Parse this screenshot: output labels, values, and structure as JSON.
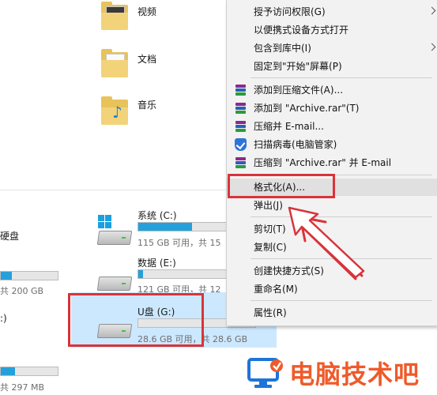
{
  "folders": [
    {
      "label": "视频",
      "icon": "video-folder-icon"
    },
    {
      "label": "文档",
      "icon": "documents-folder-icon"
    },
    {
      "label": "音乐",
      "icon": "music-folder-icon"
    }
  ],
  "left_partial": {
    "disk_label": "硬盘",
    "size1": "共 200 GB",
    "drive_letter": ":)",
    "size2": "共 297 MB"
  },
  "drives": [
    {
      "name": "系统 (C:)",
      "info": "115 GB 可用，共 15",
      "used_fraction": 0.6
    },
    {
      "name": "数据 (E:)",
      "info": "121 GB 可用，共 12",
      "used_fraction": 0.05
    },
    {
      "name": "U盘 (G:)",
      "info": "28.6 GB 可用，共 28.6 GB",
      "used_fraction": 0.0
    }
  ],
  "context_menu": {
    "items": [
      {
        "label": "授予访问权限(G)",
        "has_submenu": true
      },
      {
        "label": "以便携式设备方式打开"
      },
      {
        "label": "包含到库中(I)",
        "has_submenu": true
      },
      {
        "label": "固定到\"开始\"屏幕(P)"
      },
      {
        "label": "添加到压缩文件(A)...",
        "icon": "winrar-icon"
      },
      {
        "label": "添加到 \"Archive.rar\"(T)",
        "icon": "winrar-icon"
      },
      {
        "label": "压缩并 E-mail...",
        "icon": "winrar-icon"
      },
      {
        "label": "扫描病毒(电脑管家)",
        "icon": "shield-icon"
      },
      {
        "label": "压缩到 \"Archive.rar\" 并 E-mail",
        "icon": "winrar-icon"
      },
      {
        "label": "格式化(A)..."
      },
      {
        "label": "弹出(J)"
      },
      {
        "label": "剪切(T)"
      },
      {
        "label": "复制(C)"
      },
      {
        "label": "创建快捷方式(S)"
      },
      {
        "label": "重命名(M)"
      },
      {
        "label": "属性(R)"
      }
    ]
  },
  "watermark": {
    "text": "电脑技术吧"
  },
  "colors": {
    "highlight": "#d8343a",
    "selection": "#cce8ff",
    "bar_fill": "#26a0da",
    "watermark": "#ef5a2a"
  }
}
